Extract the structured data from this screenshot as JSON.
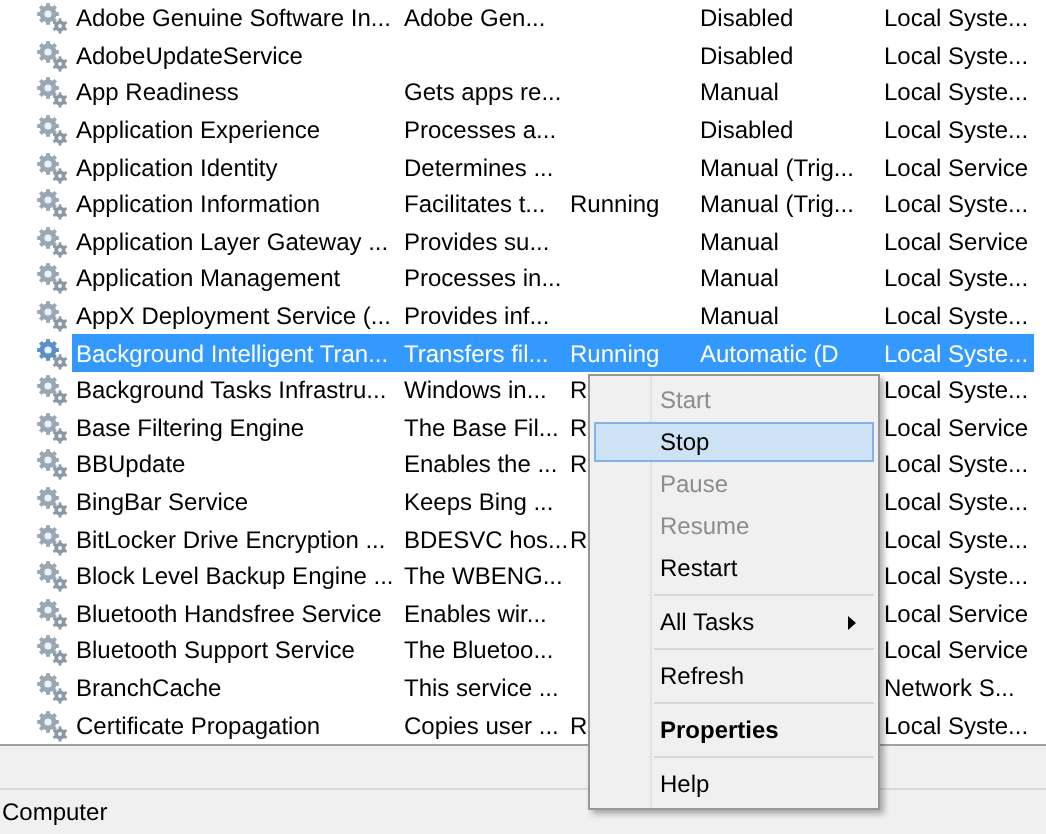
{
  "services": [
    {
      "name": "Adobe Genuine Software In...",
      "description": "Adobe Gen...",
      "startup": "Disabled",
      "logon": "Local Syste...",
      "selected": false
    },
    {
      "name": "AdobeUpdateService",
      "startup": "Disabled",
      "logon": "Local Syste...",
      "selected": false
    },
    {
      "name": "App Readiness",
      "description": "Gets apps re...",
      "startup": "Manual",
      "logon": "Local Syste...",
      "selected": false
    },
    {
      "name": "Application Experience",
      "description": "Processes a...",
      "startup": "Disabled",
      "logon": "Local Syste...",
      "selected": false
    },
    {
      "name": "Application Identity",
      "description": "Determines ...",
      "startup": "Manual (Trig...",
      "logon": "Local Service",
      "selected": false
    },
    {
      "name": "Application Information",
      "description": "Facilitates t...",
      "status": "Running",
      "startup": "Manual (Trig...",
      "logon": "Local Syste...",
      "selected": false
    },
    {
      "name": "Application Layer Gateway ...",
      "description": "Provides su...",
      "startup": "Manual",
      "logon": "Local Service",
      "selected": false
    },
    {
      "name": "Application Management",
      "description": "Processes in...",
      "startup": "Manual",
      "logon": "Local Syste...",
      "selected": false
    },
    {
      "name": "AppX Deployment Service (...",
      "description": "Provides inf...",
      "startup": "Manual",
      "logon": "Local Syste...",
      "selected": false
    },
    {
      "name": "Background Intelligent Tran...",
      "description": "Transfers fil...",
      "status": "Running",
      "startup": "Automatic (D",
      "logon": "Local Syste...",
      "selected": true
    },
    {
      "name": "Background Tasks Infrastru...",
      "description": "Windows in...",
      "status": "R",
      "logon": "Local Syste...",
      "selected": false
    },
    {
      "name": "Base Filtering Engine",
      "description": "The Base Fil...",
      "status": "R",
      "logon": "Local Service",
      "selected": false
    },
    {
      "name": "BBUpdate",
      "description": "Enables the ...",
      "status": "R",
      "logon": "Local Syste...",
      "selected": false
    },
    {
      "name": "BingBar Service",
      "description": "Keeps Bing ...",
      "logon": "Local Syste...",
      "selected": false
    },
    {
      "name": "BitLocker Drive Encryption ...",
      "description": "BDESVC hos...",
      "status": "R",
      "logon": "Local Syste...",
      "selected": false
    },
    {
      "name": "Block Level Backup Engine ...",
      "description": "The WBENG...",
      "logon": "Local Syste...",
      "selected": false
    },
    {
      "name": "Bluetooth Handsfree Service",
      "description": "Enables wir...",
      "logon": "Local Service",
      "selected": false
    },
    {
      "name": "Bluetooth Support Service",
      "description": "The Bluetoo...",
      "logon": "Local Service",
      "selected": false
    },
    {
      "name": "BranchCache",
      "description": "This service ...",
      "logon": "Network S...",
      "selected": false
    },
    {
      "name": "Certificate Propagation",
      "description": "Copies user ...",
      "status": "R",
      "logon": "Local Syste...",
      "selected": false
    }
  ],
  "context_menu": [
    {
      "kind": "item",
      "label": "Start",
      "disabled": true,
      "hovered": false,
      "bold": false,
      "submenu": false
    },
    {
      "kind": "item",
      "label": "Stop",
      "disabled": false,
      "hovered": true,
      "bold": false,
      "submenu": false
    },
    {
      "kind": "item",
      "label": "Pause",
      "disabled": true,
      "hovered": false,
      "bold": false,
      "submenu": false
    },
    {
      "kind": "item",
      "label": "Resume",
      "disabled": true,
      "hovered": false,
      "bold": false,
      "submenu": false
    },
    {
      "kind": "item",
      "label": "Restart",
      "disabled": false,
      "hovered": false,
      "bold": false,
      "submenu": false
    },
    {
      "kind": "separator"
    },
    {
      "kind": "item",
      "label": "All Tasks",
      "disabled": false,
      "hovered": false,
      "bold": false,
      "submenu": true
    },
    {
      "kind": "separator"
    },
    {
      "kind": "item",
      "label": "Refresh",
      "disabled": false,
      "hovered": false,
      "bold": false,
      "submenu": false
    },
    {
      "kind": "separator"
    },
    {
      "kind": "item",
      "label": "Properties",
      "disabled": false,
      "hovered": false,
      "bold": true,
      "submenu": false
    },
    {
      "kind": "separator"
    },
    {
      "kind": "item",
      "label": "Help",
      "disabled": false,
      "hovered": false,
      "bold": false,
      "submenu": false
    }
  ],
  "status_bar": {
    "text": "Computer"
  }
}
